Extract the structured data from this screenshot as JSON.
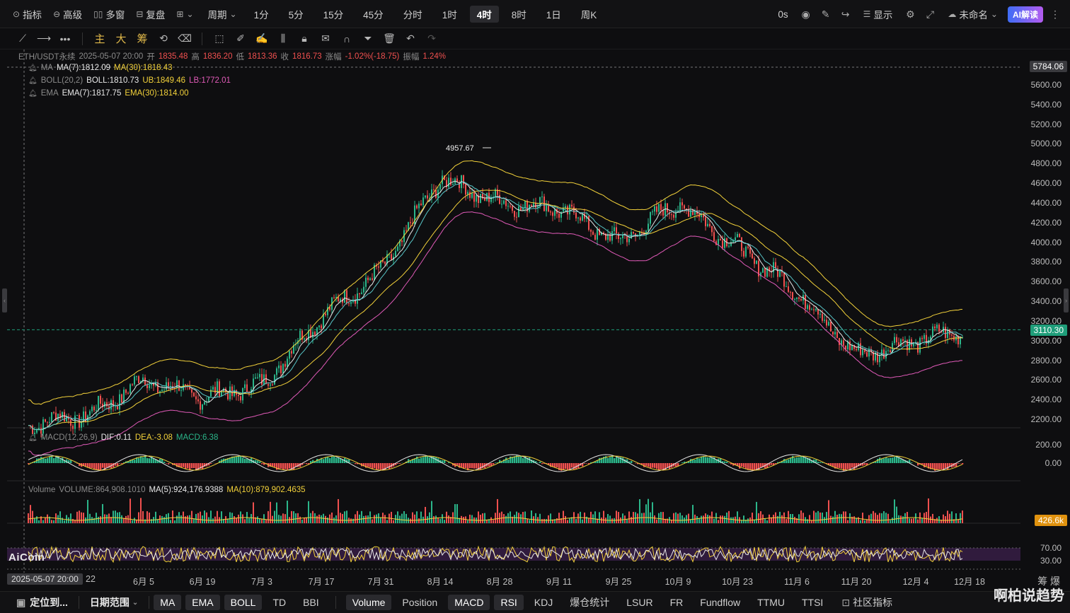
{
  "topbar": {
    "left": [
      {
        "icon": "indicator-icon",
        "label": "指标"
      },
      {
        "icon": "advanced-icon",
        "label": "高级"
      },
      {
        "icon": "multi-window-icon",
        "label": "多窗"
      },
      {
        "icon": "replay-icon",
        "label": "复盘"
      },
      {
        "icon": "layout-icon",
        "label": ""
      }
    ],
    "period_label": "周期",
    "periods": [
      "1分",
      "5分",
      "15分",
      "45分",
      "分时",
      "1时",
      "4时",
      "8时",
      "1日",
      "周K"
    ],
    "active_period": "4时",
    "countdown": "0s",
    "display_label": "显示",
    "layout_name": "未命名",
    "ai_label": "AI解读"
  },
  "toolbar2": {
    "cn_tools": [
      "主",
      "大",
      "筹"
    ]
  },
  "legend": {
    "symbol": "ETH/USDT永续",
    "datetime": "2025-05-07 20:00",
    "open_label": "开",
    "open": "1835.48",
    "high_label": "高",
    "high": "1836.20",
    "low_label": "低",
    "low": "1813.36",
    "close_label": "收",
    "close": "1816.73",
    "change_label": "涨幅",
    "change": "-1.02%(-18.75)",
    "amp_label": "振幅",
    "amp": "1.24%",
    "ma_name": "MA",
    "ma7": "MA(7):1812.09",
    "ma30": "MA(30):1818.43",
    "boll_name": "BOLL(20,2)",
    "boll": "BOLL:1810.73",
    "ub": "UB:1849.46",
    "lb": "LB:1772.01",
    "ema_name": "EMA",
    "ema7": "EMA(7):1817.75",
    "ema30": "EMA(30):1814.00",
    "macd_name": "MACD(12,26,9)",
    "dif": "DIF:0.11",
    "dea": "DEA:-3.08",
    "macd": "MACD:6.38",
    "vol_name": "Volume",
    "volume": "VOLUME:864,908.1010",
    "vma5": "MA(5):924,176.9388",
    "vma10": "MA(10):879,902.4635"
  },
  "peak_label": "4957.67",
  "y_axis": {
    "price_ticks": [
      "5600.00",
      "5400.00",
      "5200.00",
      "5000.00",
      "4800.00",
      "4600.00",
      "4400.00",
      "4200.00",
      "4000.00",
      "3800.00",
      "3600.00",
      "3400.00",
      "3200.00",
      "3000.00",
      "2800.00",
      "2600.00",
      "2400.00",
      "2200.00"
    ],
    "crosshair_price": "5784.06",
    "last_price": "3110.30",
    "macd_ticks": [
      "200.00",
      "0.00"
    ],
    "volume_tag": "426.6k",
    "rsi_ticks": [
      "70.00",
      "30.00"
    ]
  },
  "x_axis": {
    "crosshair_date": "2025-05-07 20:00",
    "labels": [
      "22",
      "6月 5",
      "6月 19",
      "7月 3",
      "7月 17",
      "7月 31",
      "8月 14",
      "8月 28",
      "9月 11",
      "9月 25",
      "10月 9",
      "10月 23",
      "11月 6",
      "11月 20",
      "12月 4",
      "12月 18"
    ]
  },
  "bottombar": {
    "locate": "定位到...",
    "range": "日期范围",
    "main_ind": [
      {
        "label": "MA",
        "on": true
      },
      {
        "label": "EMA",
        "on": true
      },
      {
        "label": "BOLL",
        "on": true
      },
      {
        "label": "TD",
        "on": false
      },
      {
        "label": "BBI",
        "on": false
      }
    ],
    "sub_ind": [
      {
        "label": "Volume",
        "on": true
      },
      {
        "label": "Position",
        "on": false
      },
      {
        "label": "MACD",
        "on": true
      },
      {
        "label": "RSI",
        "on": true
      },
      {
        "label": "KDJ",
        "on": false
      },
      {
        "label": "爆仓统计",
        "on": false
      },
      {
        "label": "LSUR",
        "on": false
      },
      {
        "label": "FR",
        "on": false
      },
      {
        "label": "Fundflow",
        "on": false
      },
      {
        "label": "TTMU",
        "on": false
      },
      {
        "label": "TTSI",
        "on": false
      }
    ],
    "community": "社区指标"
  },
  "brand": "AiCoin",
  "corner_right": "筹 爆",
  "watermark": "啊柏说趋势",
  "colors": {
    "up": "#2bb68a",
    "down": "#f0504f",
    "ma7": "#e8e8e8",
    "yellow": "#f2d13a",
    "pink": "#e05ab8",
    "ema": "#58c6c8"
  },
  "chart_data": {
    "type": "candlestick",
    "symbol": "ETH/USDT永续",
    "interval": "4时",
    "ylim": [
      2100,
      5800
    ],
    "close_path": [
      [
        "22",
        2250
      ],
      [
        "6月 5",
        2600
      ],
      [
        "6月 19",
        2420
      ],
      [
        "7月 3",
        2550
      ],
      [
        "7月 17",
        3250
      ],
      [
        "7月 31",
        3700
      ],
      [
        "8月 14",
        4650
      ],
      [
        "8月 28",
        4400
      ],
      [
        "9月 11",
        4350
      ],
      [
        "9月 25",
        4000
      ],
      [
        "10月 9",
        4400
      ],
      [
        "10月 23",
        3950
      ],
      [
        "11月 6",
        3500
      ],
      [
        "11月 20",
        2850
      ],
      [
        "12月 4",
        3000
      ],
      [
        "12月 18",
        3110
      ]
    ],
    "peak": 4957.67,
    "last": 3110.3
  }
}
